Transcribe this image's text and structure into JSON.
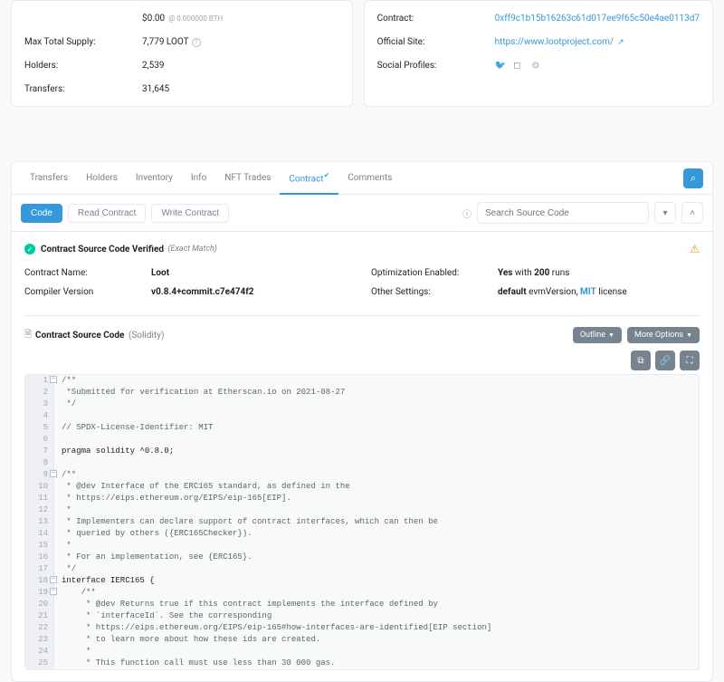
{
  "summary": {
    "left": {
      "price": {
        "label": "",
        "value": "$0.00",
        "sub": "@ 0.000000 BTH"
      },
      "maxTotal": {
        "label": "Max Total Supply:",
        "value": "7,779 LOOT"
      },
      "holders": {
        "label": "Holders:",
        "value": "2,539"
      },
      "transfers": {
        "label": "Transfers:",
        "value": "31,645"
      }
    },
    "right": {
      "contract": {
        "label": "Contract:",
        "value": "0xff9c1b15b16263c61d017ee9f65c50e4ae0113d7"
      },
      "site": {
        "label": "Official Site:",
        "value": "https://www.lootproject.com/"
      },
      "social": {
        "label": "Social Profiles:"
      }
    }
  },
  "tabs": [
    "Transfers",
    "Holders",
    "Inventory",
    "Info",
    "NFT Trades",
    "Contract",
    "Comments"
  ],
  "subtabs": {
    "code": "Code",
    "read": "Read Contract",
    "write": "Write Contract"
  },
  "search_placeholder": "Search Source Code",
  "verify": {
    "title": "Contract Source Code Verified",
    "exact": "(Exact Match)"
  },
  "meta": {
    "contractName": {
      "k": "Contract Name:",
      "v": "Loot"
    },
    "compiler": {
      "k": "Compiler Version",
      "v": "v0.8.4+commit.c7e474f2"
    },
    "optimization": {
      "k": "Optimization Enabled:",
      "v_pre": "Yes",
      "v_mid": " with ",
      "v_post": "200",
      "v_end": " runs"
    },
    "other": {
      "k": "Other Settings:",
      "v_pre": "default",
      "v_mid": " evmVersion, ",
      "v_link": "MIT",
      "v_end": " license"
    }
  },
  "sourceHdr": {
    "title": "Contract Source Code",
    "lang": "(Solidity)"
  },
  "options": {
    "outline": "Outline",
    "more": "More Options"
  },
  "code_lines": [
    "/**",
    " *Submitted for verification at Etherscan.io on 2021-08-27",
    " */",
    "",
    "// SPDX-License-Identifier: MIT",
    "",
    "pragma solidity ^0.8.0;",
    "",
    "/**",
    " * @dev Interface of the ERC165 standard, as defined in the",
    " * https://eips.ethereum.org/EIPS/eip-165[EIP].",
    " *",
    " * Implementers can declare support of contract interfaces, which can then be",
    " * queried by others ({ERC165Checker}).",
    " *",
    " * For an implementation, see {ERC165}.",
    " */",
    "interface IERC165 {",
    "    /**",
    "     * @dev Returns true if this contract implements the interface defined by",
    "     * `interfaceId`. See the corresponding",
    "     * https://eips.ethereum.org/EIPS/eip-165#how-interfaces-are-identified[EIP section]",
    "     * to learn more about how these ids are created.",
    "     *",
    "     * This function call must use less than 30 000 gas."
  ],
  "foldable_lines": [
    1,
    9,
    18,
    19
  ]
}
